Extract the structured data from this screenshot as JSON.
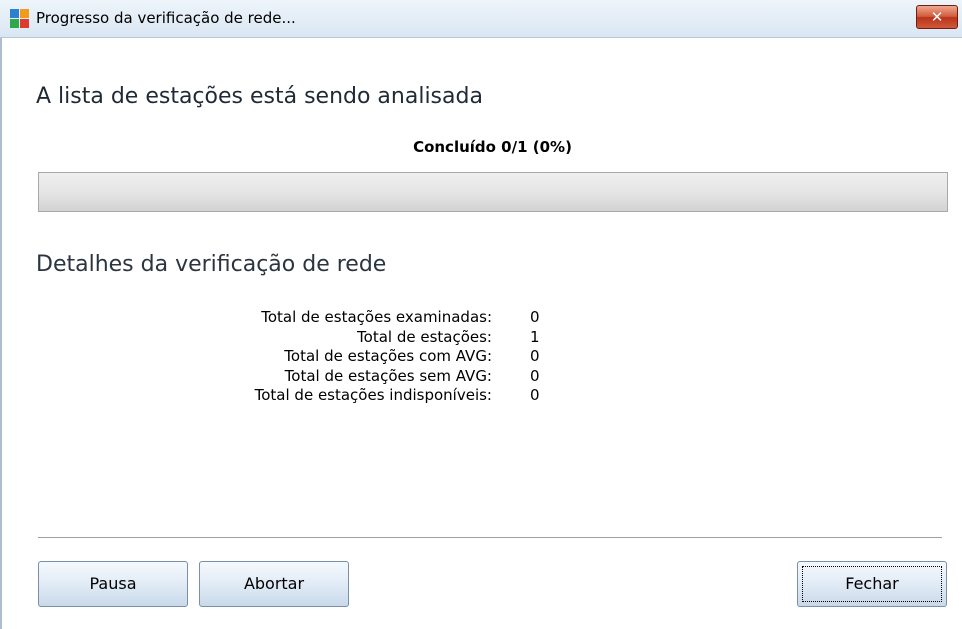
{
  "window": {
    "title": "Progresso da verificação de rede...",
    "icon": "avg-app-icon",
    "close_symbol": "✕"
  },
  "main": {
    "heading": "A lista de estações está sendo analisada",
    "progress_text": "Concluído 0/1 (0%)",
    "progress_fraction": 0
  },
  "details": {
    "heading": "Detalhes da verificação de rede",
    "rows": [
      {
        "label": "Total de estações examinadas:",
        "value": "0"
      },
      {
        "label": "Total de estações:",
        "value": "1"
      },
      {
        "label": "Total de estações com AVG:",
        "value": "0"
      },
      {
        "label": "Total de estações sem AVG:",
        "value": "0"
      },
      {
        "label": "Total de estações indisponíveis:",
        "value": "0"
      }
    ]
  },
  "buttons": {
    "pause": "Pausa",
    "abort": "Abortar",
    "close": "Fechar"
  },
  "colors": {
    "titlebar": "#d9e6f2",
    "close_button": "#c94a2c",
    "progress_fill": "#5aa428"
  }
}
